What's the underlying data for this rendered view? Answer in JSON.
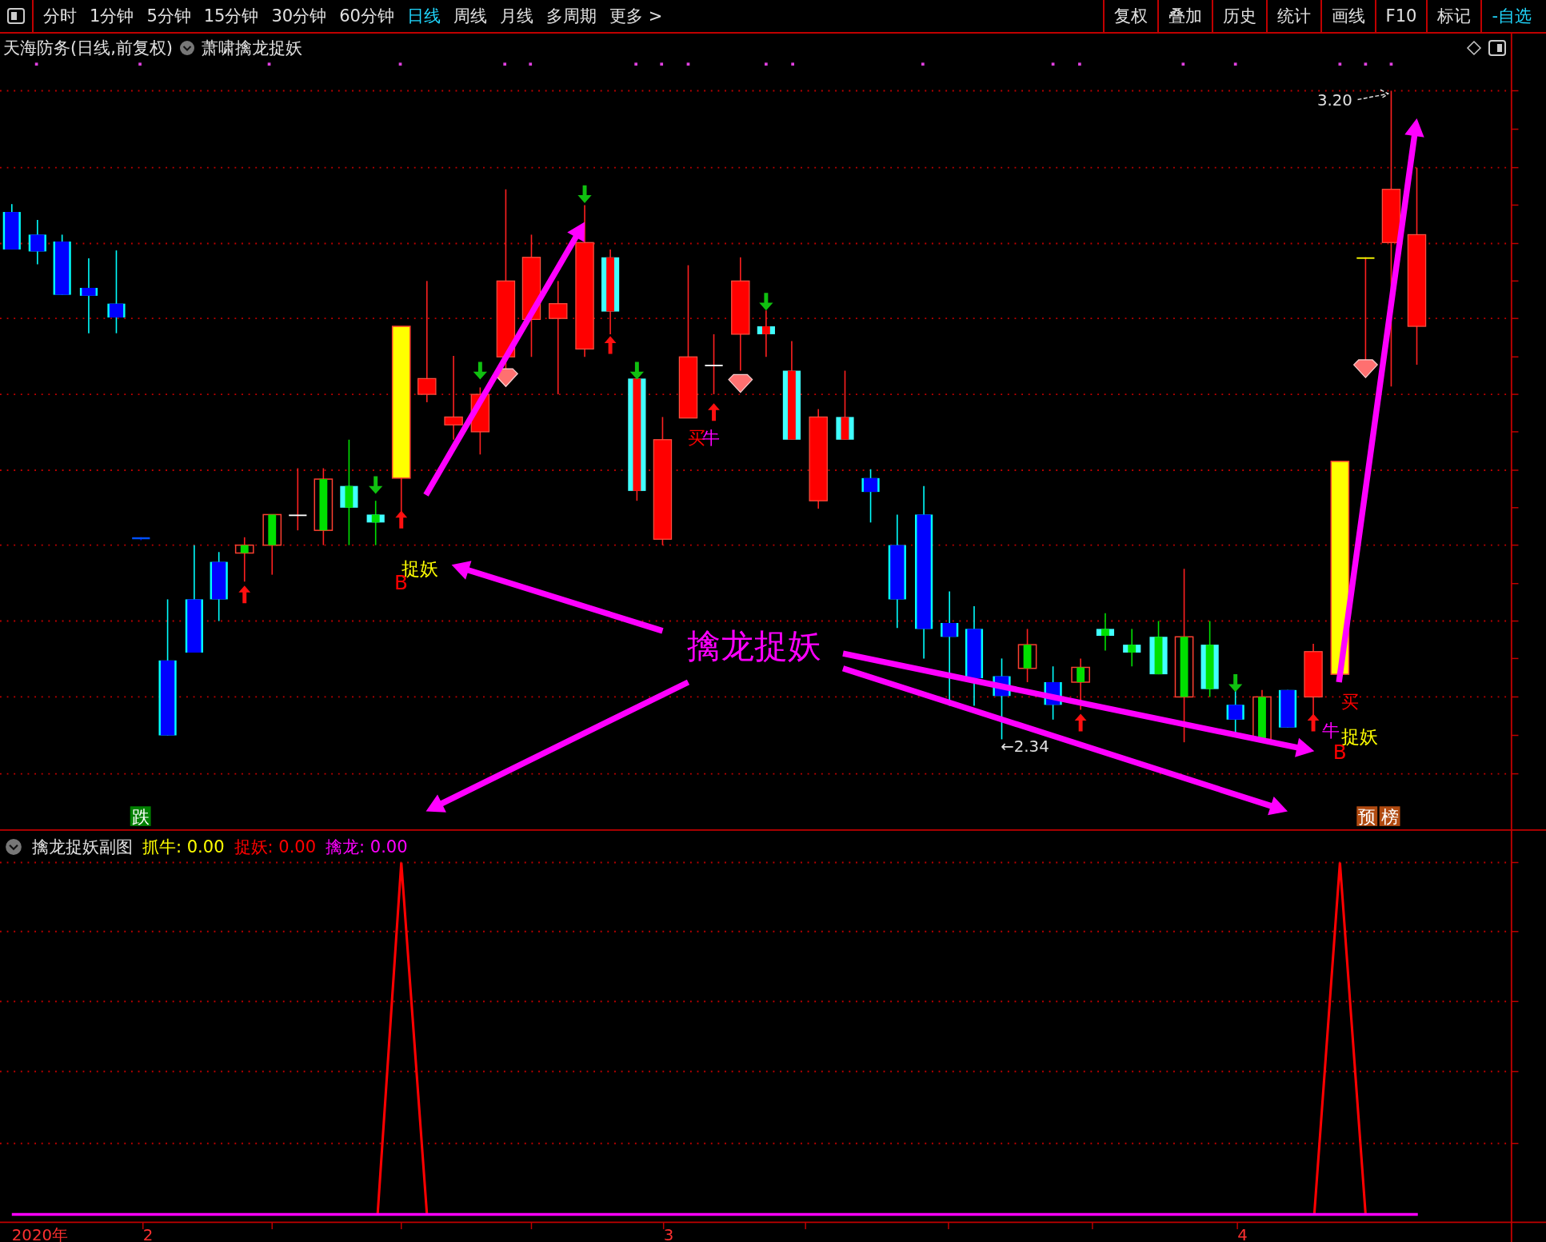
{
  "toolbar": {
    "periods": [
      {
        "label": "分时",
        "selected": false
      },
      {
        "label": "1分钟",
        "selected": false
      },
      {
        "label": "5分钟",
        "selected": false
      },
      {
        "label": "15分钟",
        "selected": false
      },
      {
        "label": "30分钟",
        "selected": false
      },
      {
        "label": "60分钟",
        "selected": false
      },
      {
        "label": "日线",
        "selected": true
      },
      {
        "label": "周线",
        "selected": false
      },
      {
        "label": "月线",
        "selected": false
      },
      {
        "label": "多周期",
        "selected": false
      },
      {
        "label": "更多 >",
        "selected": false
      }
    ],
    "tools": [
      {
        "label": "复权",
        "kind": "tool"
      },
      {
        "label": "叠加",
        "kind": "tool"
      },
      {
        "label": "历史",
        "kind": "tool"
      },
      {
        "label": "统计",
        "kind": "tool"
      },
      {
        "label": "画线",
        "kind": "tool"
      },
      {
        "label": "F10",
        "kind": "tool"
      },
      {
        "label": "标记",
        "kind": "tool"
      },
      {
        "label": "-自选",
        "kind": "watchlist"
      }
    ]
  },
  "main_chart": {
    "stock_title": "天海防务(日线,前复权)",
    "indicator": "萧啸擒龙捉妖",
    "price_marks": [
      {
        "text": "3.20",
        "kind": "high"
      },
      {
        "text": "←2.34",
        "kind": "low"
      }
    ],
    "annotations": [
      {
        "text": "捉妖",
        "color": "#ffff00"
      },
      {
        "text": "B",
        "color": "#ff0000"
      },
      {
        "text": "买",
        "color": "#ff0000"
      },
      {
        "text": "牛",
        "color": "#ff00ff"
      },
      {
        "text": "擒龙捉妖",
        "color": "#ff00ff"
      },
      {
        "text": "买",
        "color": "#ff0000"
      },
      {
        "text": "牛",
        "color": "#ff00ff"
      },
      {
        "text": "捉妖",
        "color": "#ffff00"
      },
      {
        "text": "B",
        "color": "#ff0000"
      }
    ],
    "badges": [
      {
        "text": "跌",
        "color": "#008000"
      },
      {
        "text": "预",
        "color": "#b04a10"
      },
      {
        "text": "榜",
        "color": "#b04a10"
      }
    ]
  },
  "sub_chart": {
    "title": "擒龙捉妖副图",
    "readouts": [
      {
        "text": "抓牛: 0.00",
        "color": "#ffff00"
      },
      {
        "text": "捉妖: 0.00",
        "color": "#ff0000"
      },
      {
        "text": "擒龙: 0.00",
        "color": "#ff00ff"
      }
    ]
  },
  "time_axis": {
    "labels": [
      "2020年",
      "2",
      "3",
      "4"
    ]
  }
}
